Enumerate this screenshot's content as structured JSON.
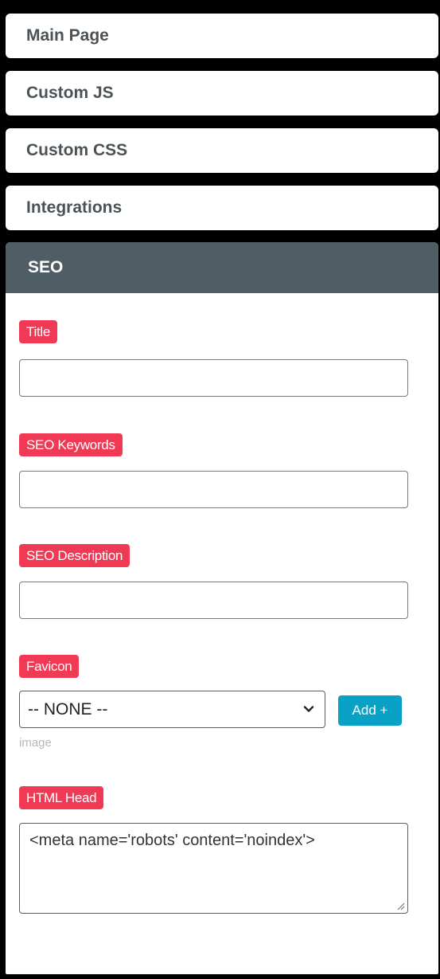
{
  "tabs": [
    {
      "label": "Main Page"
    },
    {
      "label": "Custom JS"
    },
    {
      "label": "Custom CSS"
    },
    {
      "label": "Integrations"
    }
  ],
  "seo": {
    "header": "SEO",
    "title_label": "Title",
    "title_value": "",
    "keywords_label": "SEO Keywords",
    "keywords_value": "",
    "description_label": "SEO Description",
    "description_value": "",
    "favicon_label": "Favicon",
    "favicon_selected": "-- NONE --",
    "add_button": "Add +",
    "favicon_hint": "image",
    "html_head_label": "HTML Head",
    "html_head_value": "<meta name='robots' content='noindex'>"
  },
  "colors": {
    "label_bg": "#f03a55",
    "header_bg": "#4f5d64",
    "add_button_bg": "#0aa1c7"
  }
}
